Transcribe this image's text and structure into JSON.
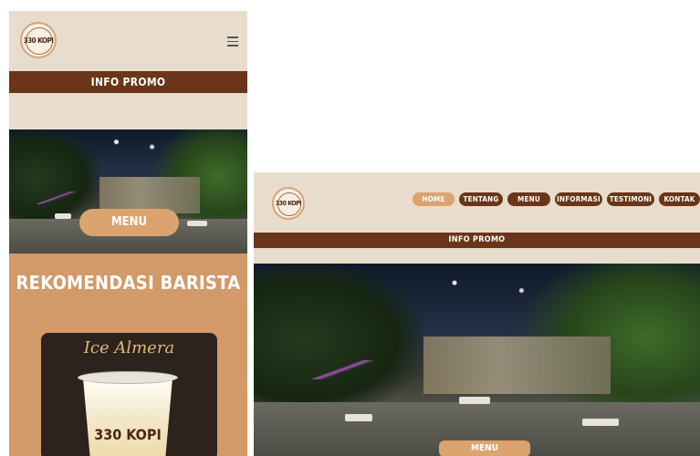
{
  "brand": {
    "logo_text": "330 KOPI"
  },
  "mobile": {
    "promo_label": "INFO PROMO",
    "menu_button": "MENU",
    "recommend_title": "REKOMENDASI BARISTA",
    "product_name": "Ice Almera",
    "cup_brand": "330 KOPI"
  },
  "desktop": {
    "nav": [
      "HOME",
      "TENTANG",
      "MENU",
      "INFORMASI",
      "TESTIMONI",
      "KONTAK"
    ],
    "active_nav": "HOME",
    "promo_label": "INFO PROMO",
    "menu_button": "MENU"
  },
  "colors": {
    "background": "#e8dccd",
    "brown": "#6a3518",
    "accent": "#dba36e",
    "section": "#d29a68"
  },
  "icons": [
    "hamburger-menu-icon",
    "cafe-photo"
  ]
}
